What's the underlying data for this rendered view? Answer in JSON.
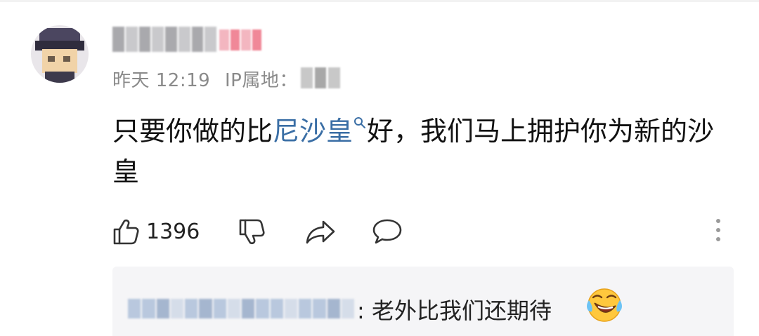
{
  "comment": {
    "meta": {
      "time": "昨天 12:19",
      "ip_label": "IP属地："
    },
    "content": {
      "before_link": "只要你做的比",
      "link_text": "尼沙皇",
      "after_link": "好，我们马上拥护你为新的沙皇"
    },
    "actions": {
      "like_count": "1396",
      "icons": [
        "thumbs-up-icon",
        "thumbs-down-icon",
        "share-icon",
        "comment-icon",
        "more-vertical-icon"
      ]
    }
  },
  "reply": {
    "text": ": 老外比我们还期待",
    "emoji": "laughing-crying-emoji"
  },
  "colors": {
    "link": "#3a6ea5",
    "meta": "#8a8a8a",
    "text": "#111111",
    "reply_bg": "#f5f5f7"
  }
}
